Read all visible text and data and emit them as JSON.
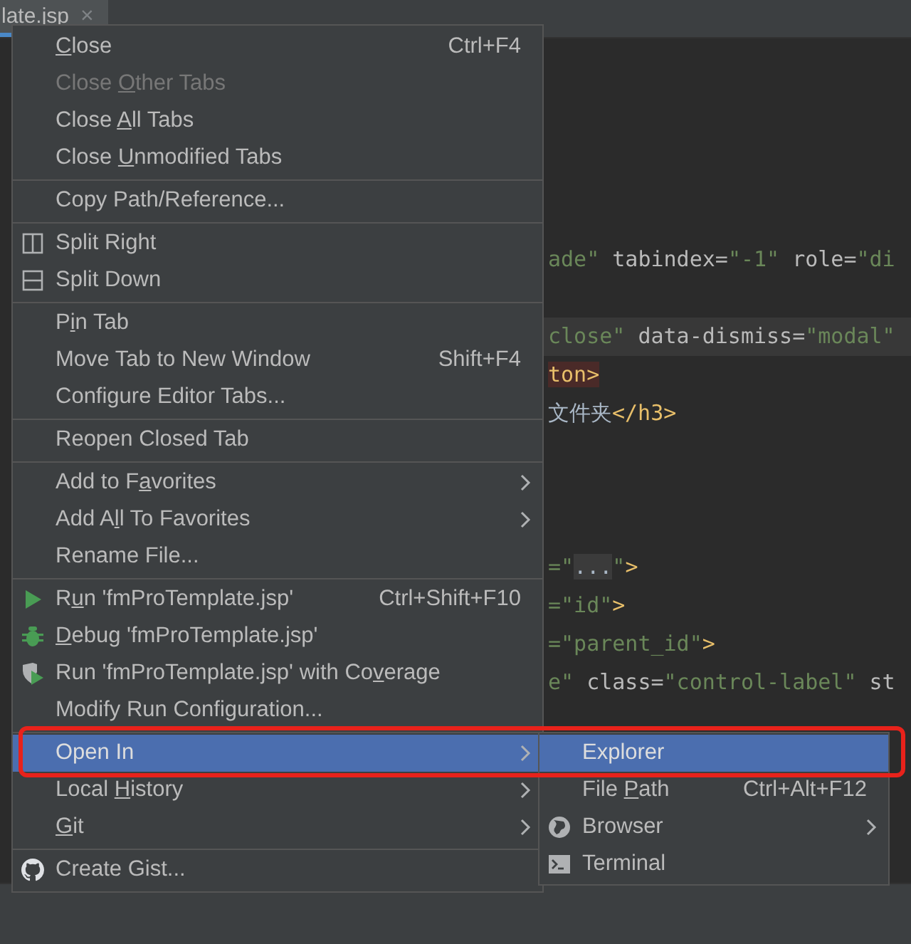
{
  "tab": {
    "title": "late.jsp",
    "close": "×",
    "selected": true
  },
  "code_lines": [
    {
      "current": false,
      "segments": [
        {
          "kind": "string",
          "text": "ade\""
        },
        {
          "kind": "attr",
          "text": " tabindex="
        },
        {
          "kind": "string",
          "text": "\"-1\""
        },
        {
          "kind": "attr",
          "text": " role="
        },
        {
          "kind": "string",
          "text": "\"di"
        }
      ]
    },
    {
      "current": true,
      "segments": [
        {
          "kind": "string",
          "text": "close\""
        },
        {
          "kind": "attr",
          "text": " data-dismiss="
        },
        {
          "kind": "string",
          "text": "\"modal\""
        }
      ]
    },
    {
      "current": false,
      "segments": [
        {
          "kind": "error-tag",
          "text": "ton>"
        }
      ]
    },
    {
      "current": false,
      "segments": [
        {
          "kind": "text",
          "text": "文件夹"
        },
        {
          "kind": "tag",
          "text": "</h3>"
        }
      ]
    },
    {
      "current": false,
      "segments": [
        {
          "kind": "string",
          "text": "=\""
        },
        {
          "kind": "fold",
          "text": "..."
        },
        {
          "kind": "string",
          "text": "\""
        },
        {
          "kind": "tag",
          "text": ">"
        }
      ]
    },
    {
      "current": false,
      "segments": [
        {
          "kind": "string",
          "text": "=\"id\""
        },
        {
          "kind": "tag",
          "text": ">"
        }
      ]
    },
    {
      "current": false,
      "segments": [
        {
          "kind": "string",
          "text": "=\"parent_id\""
        },
        {
          "kind": "tag",
          "text": ">"
        }
      ]
    },
    {
      "current": false,
      "segments": [
        {
          "kind": "string",
          "text": "e\""
        },
        {
          "kind": "attr",
          "text": " class="
        },
        {
          "kind": "string",
          "text": "\"control-label\""
        },
        {
          "kind": "attr",
          "text": " st"
        }
      ]
    }
  ],
  "context_menu": {
    "groups": [
      [
        {
          "label": "Close",
          "shortcut": "Ctrl+F4",
          "disabled": false,
          "submenu": false,
          "selected": false
        },
        {
          "label": "Close Other Tabs",
          "disabled": true,
          "submenu": false,
          "selected": false
        },
        {
          "label": "Close All Tabs",
          "disabled": false,
          "submenu": false,
          "selected": false
        },
        {
          "label": "Close Unmodified Tabs",
          "disabled": false,
          "submenu": false,
          "selected": false
        }
      ],
      [
        {
          "label": "Copy Path/Reference...",
          "disabled": false,
          "submenu": false,
          "selected": false
        }
      ],
      [
        {
          "label": "Split Right",
          "disabled": false,
          "submenu": false,
          "selected": false
        },
        {
          "label": "Split Down",
          "disabled": false,
          "submenu": false,
          "selected": false
        }
      ],
      [
        {
          "label": "Pin Tab",
          "disabled": false,
          "submenu": false,
          "selected": false
        },
        {
          "label": "Move Tab to New Window",
          "shortcut": "Shift+F4",
          "disabled": false,
          "submenu": false,
          "selected": false
        },
        {
          "label": "Configure Editor Tabs...",
          "disabled": false,
          "submenu": false,
          "selected": false
        }
      ],
      [
        {
          "label": "Reopen Closed Tab",
          "disabled": false,
          "submenu": false,
          "selected": false
        }
      ],
      [
        {
          "label": "Add to Favorites",
          "disabled": false,
          "submenu": true,
          "selected": false
        },
        {
          "label": "Add All To Favorites",
          "disabled": false,
          "submenu": true,
          "selected": false
        },
        {
          "label": "Rename File...",
          "disabled": false,
          "submenu": false,
          "selected": false
        }
      ],
      [
        {
          "label": "Run 'fmProTemplate.jsp'",
          "shortcut": "Ctrl+Shift+F10",
          "disabled": false,
          "submenu": false,
          "selected": false
        },
        {
          "label": "Debug 'fmProTemplate.jsp'",
          "disabled": false,
          "submenu": false,
          "selected": false
        },
        {
          "label": "Run 'fmProTemplate.jsp' with Coverage",
          "disabled": false,
          "submenu": false,
          "selected": false
        },
        {
          "label": "Modify Run Configuration...",
          "disabled": false,
          "submenu": false,
          "selected": false
        }
      ],
      [
        {
          "label": "Open In",
          "disabled": false,
          "submenu": true,
          "selected": true
        },
        {
          "label": "Local History",
          "disabled": false,
          "submenu": true,
          "selected": false
        },
        {
          "label": "Git",
          "disabled": false,
          "submenu": true,
          "selected": false
        }
      ],
      [
        {
          "label": "Create Gist...",
          "disabled": false,
          "submenu": false,
          "selected": false
        }
      ]
    ]
  },
  "submenu": {
    "items": [
      {
        "label": "Explorer",
        "selected": true,
        "submenu": false
      },
      {
        "label": "File Path",
        "shortcut": "Ctrl+Alt+F12",
        "selected": false,
        "submenu": false
      },
      {
        "label": "Browser",
        "selected": false,
        "submenu": true
      },
      {
        "label": "Terminal",
        "selected": false,
        "submenu": false
      }
    ]
  }
}
